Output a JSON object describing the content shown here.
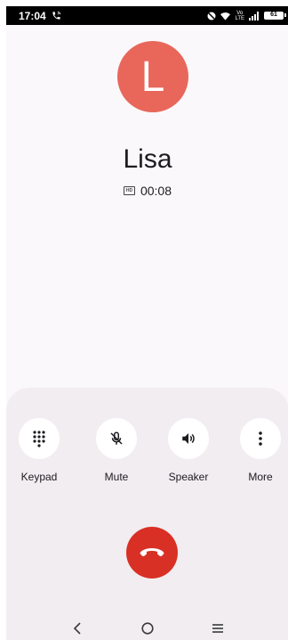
{
  "status_bar": {
    "time": "17:04",
    "network": "LTE",
    "network_prefix": "Vo",
    "battery": "61",
    "icons": [
      "call-active-icon",
      "dnd-icon",
      "wifi-icon",
      "signal-icon",
      "battery-icon"
    ]
  },
  "call": {
    "avatar_letter": "L",
    "avatar_color": "#e8675a",
    "contact_name": "Lisa",
    "hd_badge": "HD",
    "duration": "00:08"
  },
  "controls": [
    {
      "label": "Keypad",
      "icon": "keypad-icon"
    },
    {
      "label": "Mute",
      "icon": "mic-off-icon"
    },
    {
      "label": "Speaker",
      "icon": "speaker-icon"
    },
    {
      "label": "More",
      "icon": "more-vert-icon"
    }
  ],
  "end_call": {
    "icon": "call-end-icon",
    "color": "#d93025"
  },
  "nav": [
    "back-icon",
    "home-icon",
    "recents-icon"
  ]
}
